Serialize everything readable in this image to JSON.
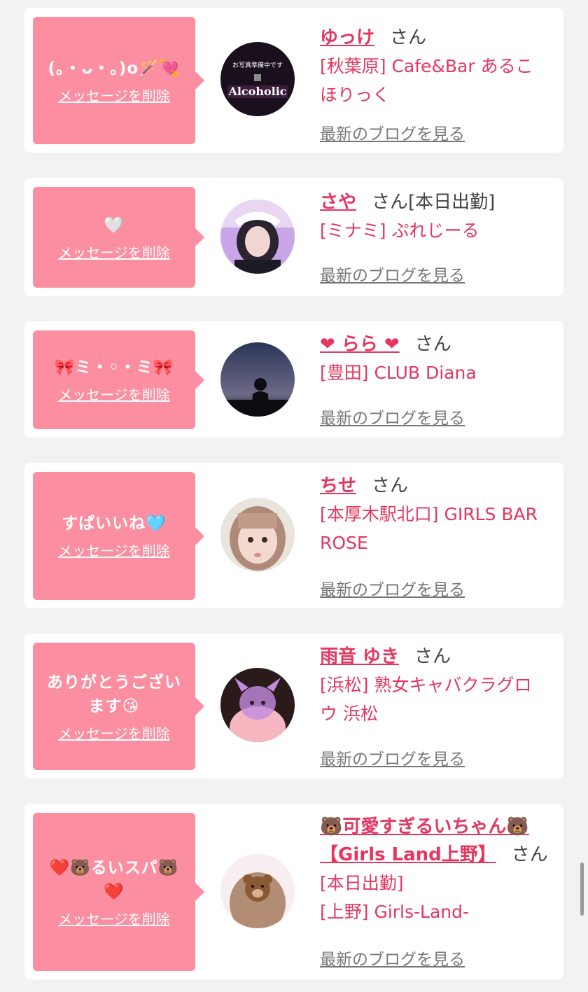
{
  "colors": {
    "page_bg": "#f2f2f2",
    "bubble": "#fb8ea0",
    "name": "#e5365f",
    "link_gray": "#777777"
  },
  "cards": [
    {
      "message": "(｡・ᴗ・｡)o🪄💘",
      "delete_label": "メッセージを削除",
      "name": "ゆっけ",
      "suffix": "さん",
      "shop": "[秋葉原] Cafe&Bar あるこほりっく",
      "blog_label": "最新のブログを見る",
      "avatar_icon": "alcoholic-logo-avatar",
      "avatar_text": "Alcoholic",
      "avatar_subtext": "お写真準備中です"
    },
    {
      "message": "🤍",
      "delete_label": "メッセージを削除",
      "name": "さや",
      "suffix": "さん[本日出勤]",
      "shop": "[ミナミ] ぷれじーる",
      "blog_label": "最新のブログを見る",
      "avatar_icon": "girl-photo-avatar"
    },
    {
      "message": "🎀ミ・◦・ミ🎀",
      "delete_label": "メッセージを削除",
      "name": "❤︎ らら ❤︎",
      "suffix": "さん",
      "shop": "[豊田] CLUB Diana",
      "blog_label": "最新のブログを見る",
      "avatar_icon": "silhouette-night-avatar"
    },
    {
      "message": "すぱいいね🩵",
      "delete_label": "メッセージを削除",
      "name": "ちせ",
      "suffix": "さん",
      "shop": "[本厚木駅北口] GIRLS BAR ROSE",
      "blog_label": "最新のブログを見る",
      "avatar_icon": "girl-face-avatar"
    },
    {
      "message": "ありがとうございます😘",
      "delete_label": "メッセージを削除",
      "name": "雨音 ゆき",
      "suffix": "さん",
      "shop": "[浜松] 熟女キャバクラグロウ 浜松",
      "blog_label": "最新のブログを見る",
      "avatar_icon": "kuromi-sticker-avatar"
    },
    {
      "message": "❤️🐻るいスパ🐻❤️",
      "delete_label": "メッセージを削除",
      "name": "🐻可愛すぎるいちゃん🐻【Girls Land上野】",
      "suffix": "さん",
      "shop": "[本日出勤]\n[上野] Girls-Land-",
      "blog_label": "最新のブログを見る",
      "avatar_icon": "bear-sticker-avatar"
    }
  ]
}
